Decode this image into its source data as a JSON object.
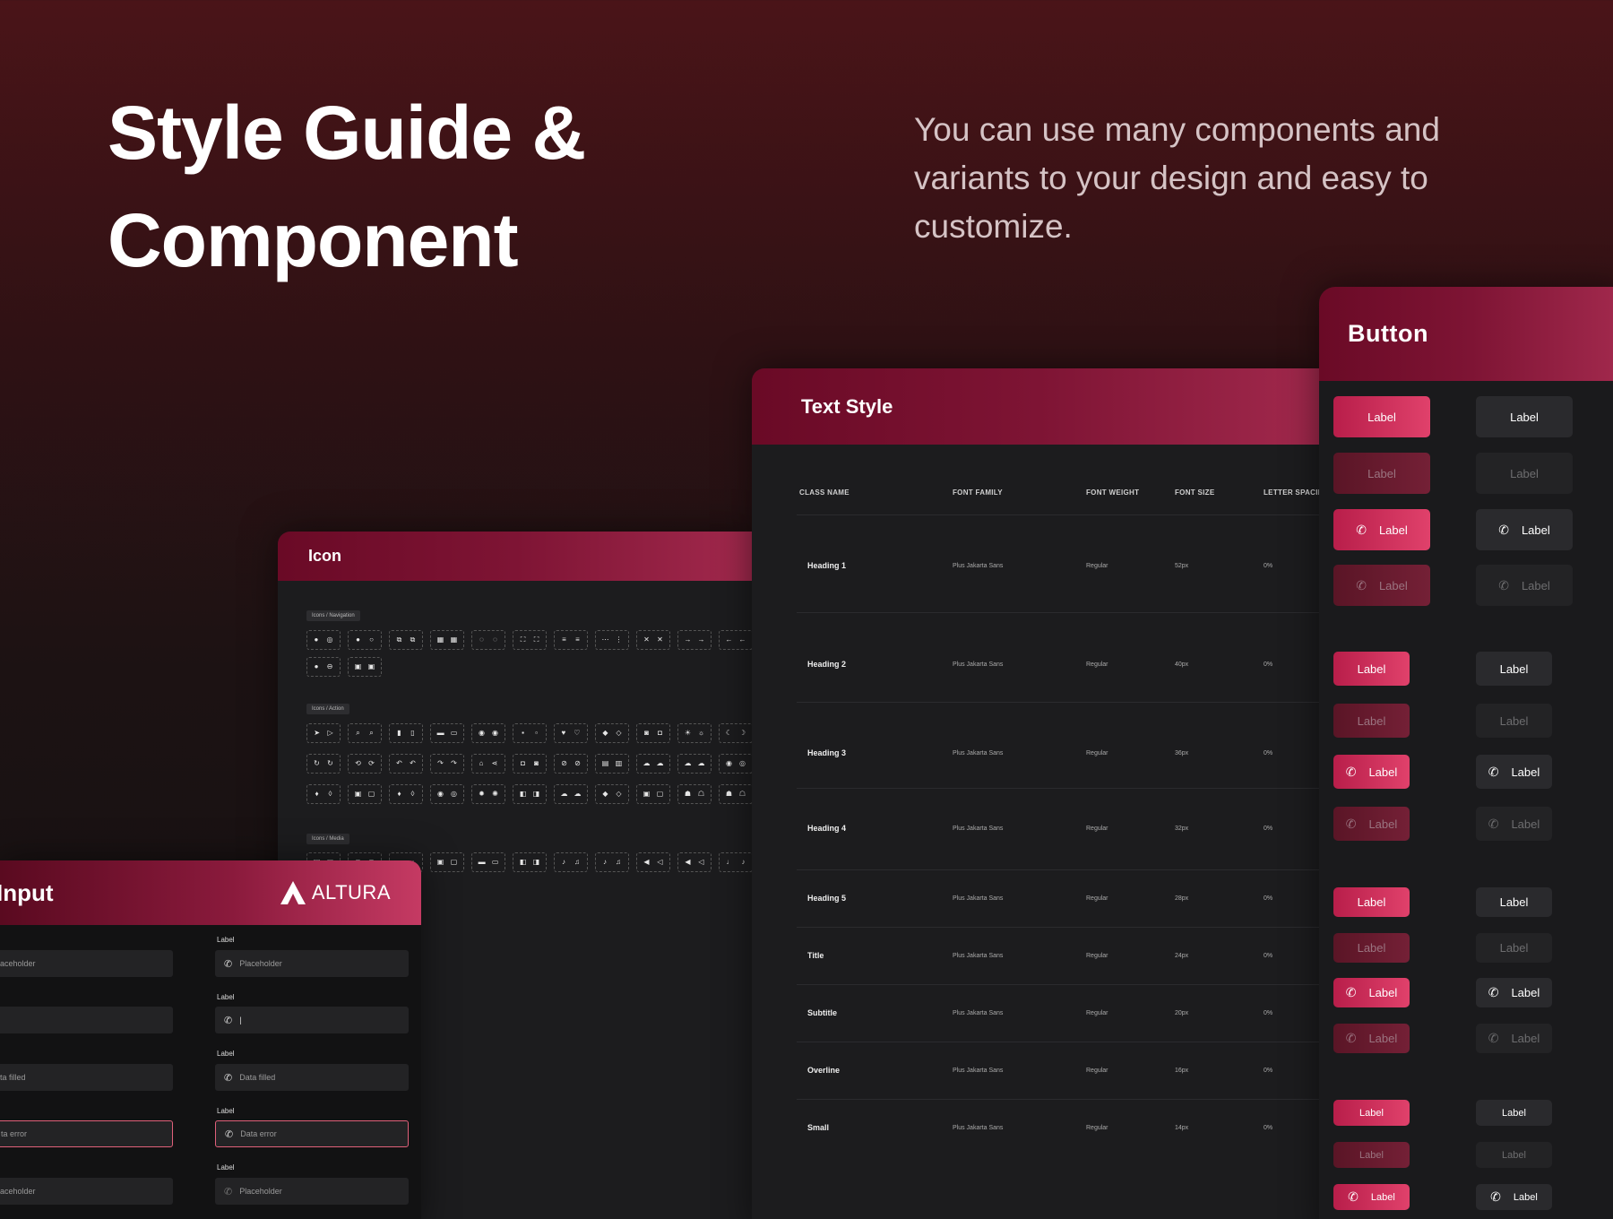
{
  "hero": {
    "title_line1": "Style Guide &",
    "title_line2": "Component",
    "description": "You can use many components and variants to your design and easy to customize."
  },
  "icon_panel": {
    "title": "Icon",
    "sections": [
      {
        "tag": "Icons / Navigation"
      },
      {
        "tag": "Icons / Action"
      },
      {
        "tag": "Icons / Media"
      }
    ]
  },
  "text_style": {
    "title": "Text Style",
    "columns": [
      "CLASS NAME",
      "FONT FAMILY",
      "FONT WEIGHT",
      "FONT SIZE",
      "LETTER SPACIN"
    ],
    "rows": [
      {
        "name": "Heading 1",
        "family": "Plus Jakarta Sans",
        "weight": "Regular",
        "size": "52px",
        "spacing": "0%"
      },
      {
        "name": "Heading 2",
        "family": "Plus Jakarta Sans",
        "weight": "Regular",
        "size": "40px",
        "spacing": "0%"
      },
      {
        "name": "Heading 3",
        "family": "Plus Jakarta Sans",
        "weight": "Regular",
        "size": "36px",
        "spacing": "0%"
      },
      {
        "name": "Heading 4",
        "family": "Plus Jakarta Sans",
        "weight": "Regular",
        "size": "32px",
        "spacing": "0%"
      },
      {
        "name": "Heading 5",
        "family": "Plus Jakarta Sans",
        "weight": "Regular",
        "size": "28px",
        "spacing": "0%"
      },
      {
        "name": "Title",
        "family": "Plus Jakarta Sans",
        "weight": "Regular",
        "size": "24px",
        "spacing": "0%"
      },
      {
        "name": "Subtitle",
        "family": "Plus Jakarta Sans",
        "weight": "Regular",
        "size": "20px",
        "spacing": "0%"
      },
      {
        "name": "Overline",
        "family": "Plus Jakarta Sans",
        "weight": "Regular",
        "size": "16px",
        "spacing": "0%"
      },
      {
        "name": "Small",
        "family": "Plus Jakarta Sans",
        "weight": "Regular",
        "size": "14px",
        "spacing": "0%"
      }
    ]
  },
  "button_panel": {
    "title": "Button",
    "label": "Label"
  },
  "input_panel": {
    "title": "Input",
    "brand": "ALTURA",
    "field_label": "Label",
    "left_values": [
      "aceholder",
      "",
      "ta filled",
      "ta error",
      "aceholder"
    ],
    "right_values": [
      "Placeholder",
      "|",
      "Data filled",
      "Data error",
      "Placeholder"
    ]
  },
  "colors": {
    "accent": "#d6355f",
    "accent_dark": "#6a0a26",
    "panel_bg": "#1c1c1e",
    "page_bg_top": "#4a1418"
  },
  "icons": {
    "phone": "phone-icon",
    "brand": "altura-logo-icon"
  }
}
